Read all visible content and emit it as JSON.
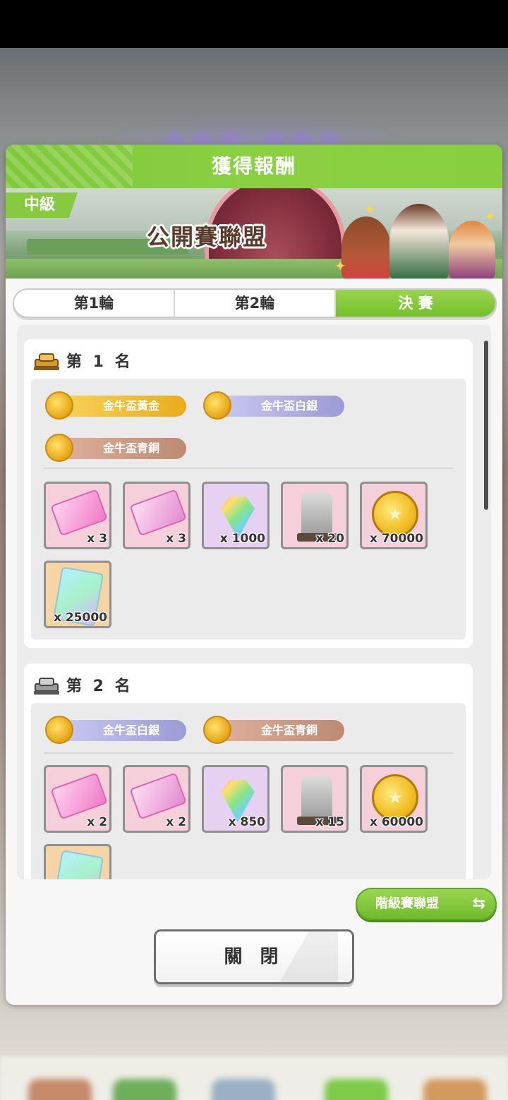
{
  "dialog": {
    "title": "獲得報酬",
    "level_tag": "中級",
    "league_name": "公開賽聯盟"
  },
  "tabs": [
    {
      "label": "第1輪",
      "active": false
    },
    {
      "label": "第2輪",
      "active": false
    },
    {
      "label": "決 賽",
      "active": true
    }
  ],
  "ranks": [
    {
      "label": "第 1 名",
      "badges": [
        {
          "label": "金牛盃黃金",
          "color": "#f2c23a"
        },
        {
          "label": "金牛盃白銀",
          "color": "#b8b8e6"
        },
        {
          "label": "金牛盃青銅",
          "color": "#cf9a82"
        }
      ],
      "items": [
        {
          "icon": "ticket-icon",
          "qty": "x 3"
        },
        {
          "icon": "ticket-icon",
          "qty": "x 3"
        },
        {
          "icon": "carrot-icon",
          "qty": "x 1000"
        },
        {
          "icon": "statue-icon",
          "qty": "x 20"
        },
        {
          "icon": "coin-icon",
          "qty": "x 70000"
        },
        {
          "icon": "card-icon",
          "qty": "x 25000"
        }
      ]
    },
    {
      "label": "第 2 名",
      "badges": [
        {
          "label": "金牛盃白銀",
          "color": "#b8b8e6"
        },
        {
          "label": "金牛盃青銅",
          "color": "#cf9a82"
        }
      ],
      "items": [
        {
          "icon": "ticket-icon",
          "qty": "x 2"
        },
        {
          "icon": "ticket-icon",
          "qty": "x 2"
        },
        {
          "icon": "carrot-icon",
          "qty": "x 850"
        },
        {
          "icon": "statue-icon",
          "qty": "x 15"
        },
        {
          "icon": "coin-icon",
          "qty": "x 60000"
        },
        {
          "icon": "card-icon",
          "qty": ""
        }
      ]
    }
  ],
  "buttons": {
    "league_switch": "階級賽聯盟",
    "close": "關 閉"
  },
  "colors": {
    "accent_green": "#86ca40"
  }
}
